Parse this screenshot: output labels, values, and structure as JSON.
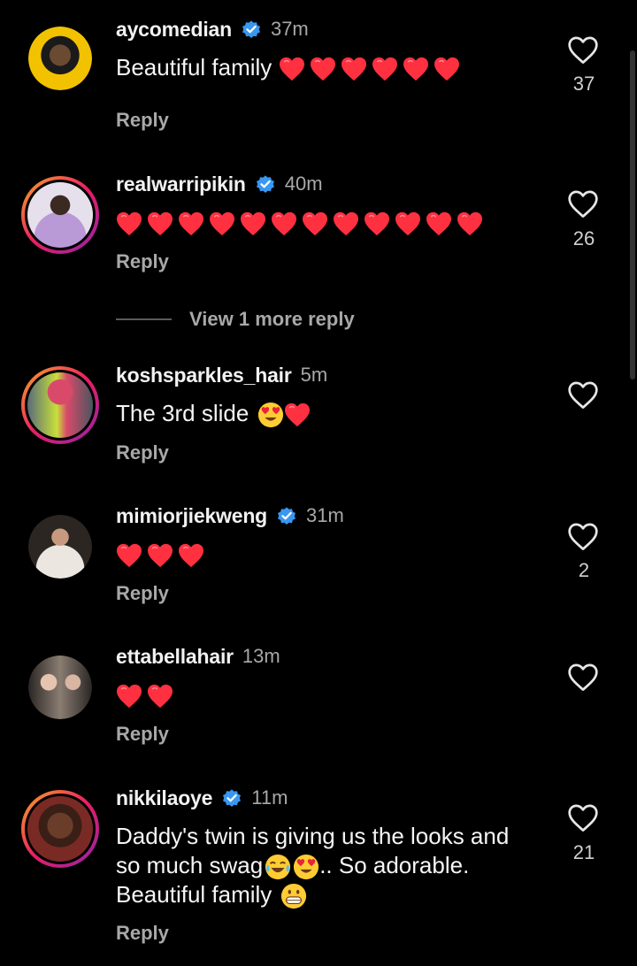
{
  "comments": [
    {
      "username": "aycomedian",
      "time": "37m",
      "text_prefix": "Beautiful family",
      "hearts": 6,
      "reply": "Reply",
      "likes": "37",
      "verified": true
    },
    {
      "username": "realwarripikin",
      "time": "40m",
      "text_prefix": "",
      "hearts": 12,
      "reply": "Reply",
      "likes": "26",
      "verified": true
    },
    {
      "username": "koshsparkles_hair",
      "time": "5m",
      "text_prefix": "The 3rd slide",
      "reply": "Reply",
      "likes": "",
      "verified": false
    },
    {
      "username": "mimiorjiekweng",
      "time": "31m",
      "text_prefix": "",
      "hearts": 3,
      "reply": "Reply",
      "likes": "2",
      "verified": true
    },
    {
      "username": "ettabellahair",
      "time": "13m",
      "text_prefix": "",
      "hearts": 2,
      "reply": "Reply",
      "likes": "",
      "verified": false
    },
    {
      "username": "nikkilaoye",
      "time": "11m",
      "line1": "Daddy's twin is giving us the looks and",
      "line2_prefix": "so much swag",
      "line2_suffix": ".. So adorable.",
      "line3_prefix": "Beautiful family",
      "reply": "Reply",
      "likes": "21",
      "verified": true
    }
  ],
  "view_more_replies": "View 1 more reply",
  "colors": {
    "background": "#000000",
    "verified": "#3897f0",
    "heart": "#ff3040",
    "secondary_text": "#a8a8a8"
  }
}
